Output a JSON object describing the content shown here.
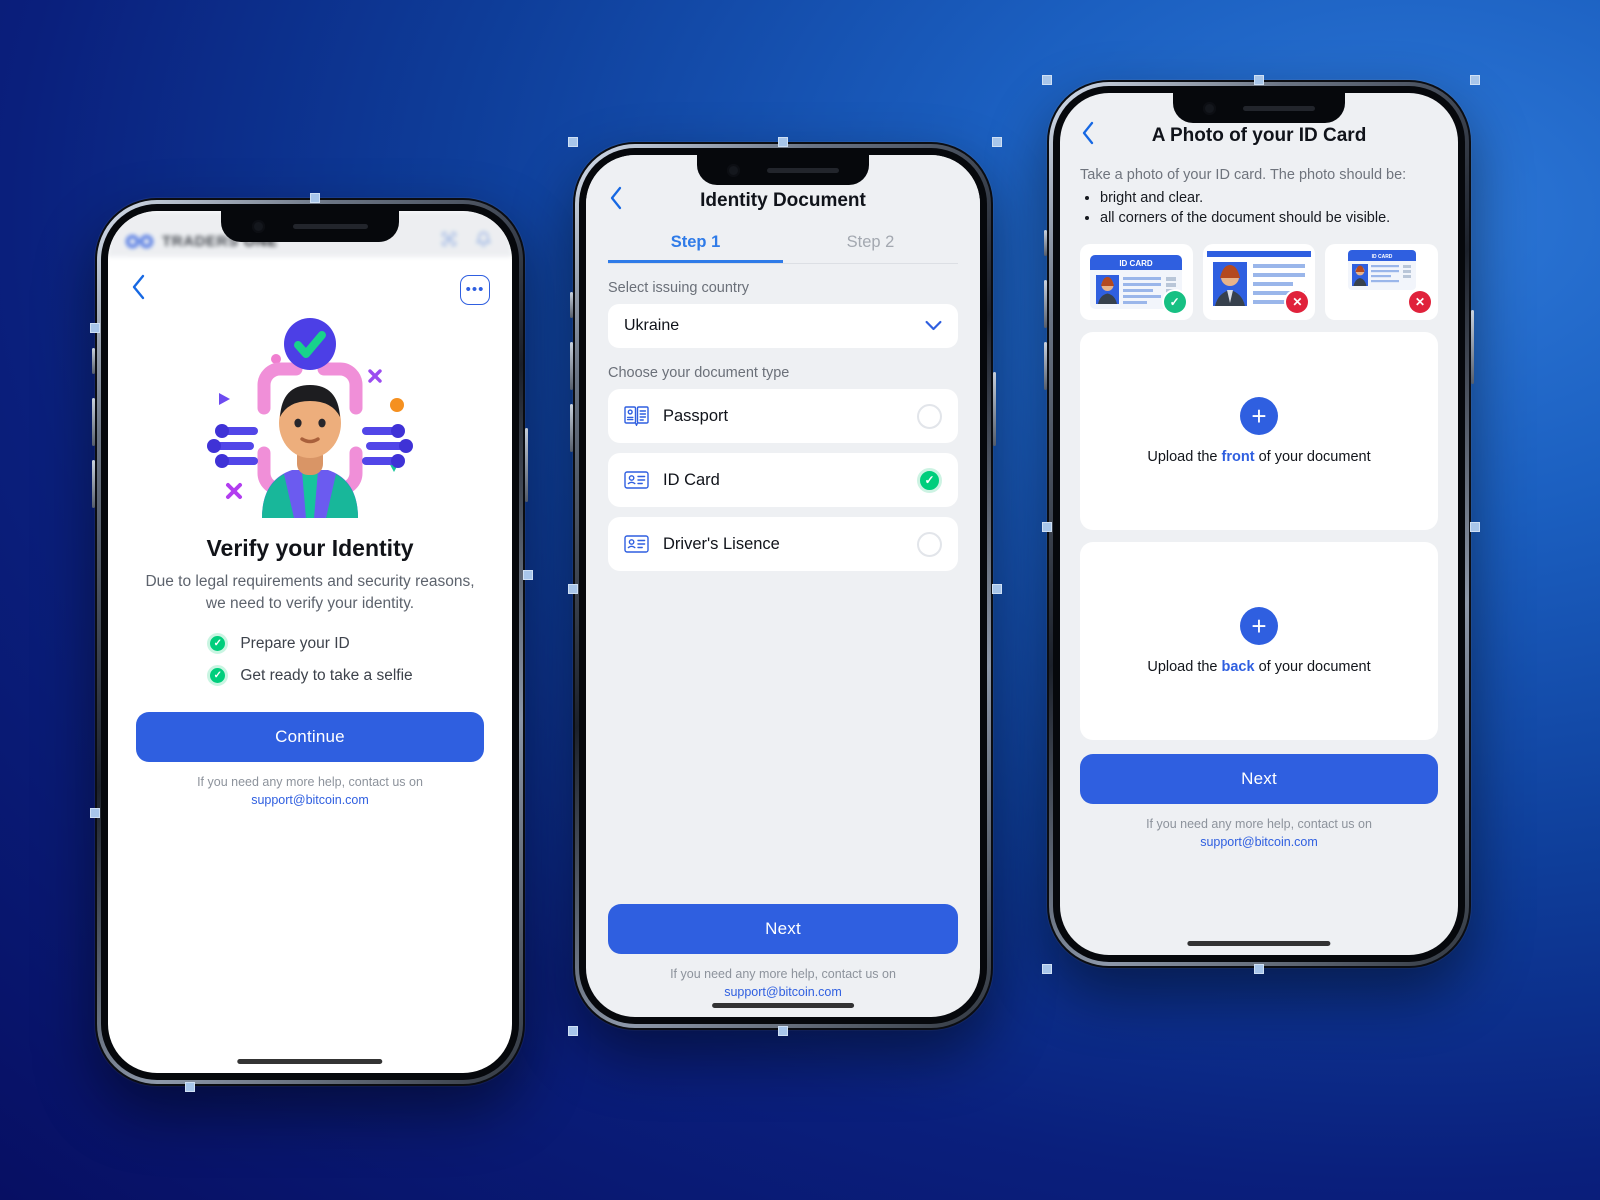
{
  "background": {
    "dark": "#0A1272",
    "light": "#1B5FC0"
  },
  "colors": {
    "primary_blue": "#2F5FE0",
    "link_blue": "#2F7BE8",
    "success_green": "#00CE7C",
    "error_red": "#E0223B"
  },
  "phone1": {
    "appbar": {
      "brand_first": "TRADERS ",
      "brand_second": "ONE",
      "logo_icon": "infinity-logo-icon",
      "scan_icon": "scan-qr-icon",
      "bell_icon": "bell-icon"
    },
    "back_icon": "chevron-left-icon",
    "more_label": "•••",
    "illustration": "identity-verification-illustration",
    "title": "Verify your Identity",
    "subtitle": "Due to legal requirements and security reasons, we need to verify your identity.",
    "checklist": [
      {
        "label": "Prepare your ID",
        "icon": "check-circle-icon"
      },
      {
        "label": "Get ready to take a selfie",
        "icon": "check-circle-icon"
      }
    ],
    "cta_label": "Continue",
    "help_text": "If you need any more help, contact us on",
    "help_email": "support@bitcoin.com"
  },
  "phone2": {
    "back_icon": "chevron-left-icon",
    "title": "Identity Document",
    "tabs": [
      {
        "label": "Step 1",
        "active": true
      },
      {
        "label": "Step 2",
        "active": false
      }
    ],
    "country_label": "Select issuing country",
    "country_value": "Ukraine",
    "country_chevron": "chevron-down-icon",
    "doctype_label": "Choose your document type",
    "documents": [
      {
        "label": "Passport",
        "icon": "passport-icon",
        "selected": false
      },
      {
        "label": "ID Card",
        "icon": "id-card-icon",
        "selected": true
      },
      {
        "label": "Driver's Lisence",
        "icon": "drivers-license-icon",
        "selected": false
      }
    ],
    "cta_label": "Next",
    "help_text": "If you need any more help, contact us on",
    "help_email": "support@bitcoin.com"
  },
  "phone3": {
    "back_icon": "chevron-left-icon",
    "title": "A Photo of your ID Card",
    "intro": "Take a photo of your ID card. The photo should be:",
    "bullets": [
      "bright and clear.",
      "all corners of the document should be visible."
    ],
    "samples": [
      {
        "name": "sample-good",
        "status": "ok",
        "badge": "✓",
        "card_label": "ID CARD"
      },
      {
        "name": "sample-cropped",
        "status": "bad",
        "badge": "✕",
        "card_label": ""
      },
      {
        "name": "sample-too-small",
        "status": "bad",
        "badge": "✕",
        "card_label": "ID CARD"
      }
    ],
    "uploads": [
      {
        "prefix": "Upload the ",
        "highlight": "front",
        "suffix": " of your document",
        "plus": "+"
      },
      {
        "prefix": "Upload the ",
        "highlight": "back",
        "suffix": " of your document",
        "plus": "+"
      }
    ],
    "cta_label": "Next",
    "help_text": "If you need any more help, contact us on",
    "help_email": "support@bitcoin.com"
  }
}
